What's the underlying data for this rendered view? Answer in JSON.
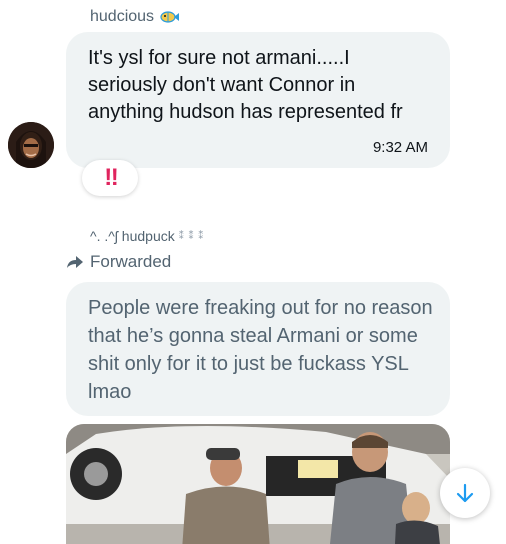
{
  "messages": [
    {
      "sender": "hudcious",
      "sender_icon": "fish-icon",
      "text": "It's ysl for sure not armani.....I seriously  don't want Connor in anything  hudson has represented fr",
      "time": "9:32 AM",
      "reaction": "‼",
      "reaction_icon": "double-exclamation-icon"
    },
    {
      "sender": "^. .^ʃ hudpuck",
      "sender_decoration": "⁑ ⁑ ⁑",
      "forwarded_label": "Forwarded",
      "text": "People were freaking out for no reason that he’s gonna steal Armani or some shit only for it to just be fuckass YSL lmao",
      "attachment": "photo"
    }
  ],
  "controls": {
    "scroll_down_icon": "arrow-down-icon"
  },
  "colors": {
    "bubble": "#eff3f4",
    "muted_text": "#536471",
    "primary_text": "#0f1419",
    "accent": "#1d9bf0",
    "reaction": "#e0245e"
  }
}
